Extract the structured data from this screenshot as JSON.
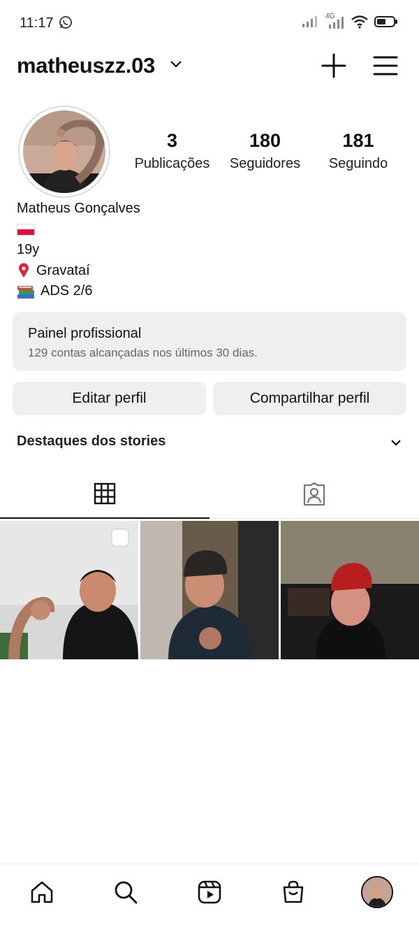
{
  "status_bar": {
    "time": "11:17",
    "network": "4G"
  },
  "header": {
    "username": "matheuszz.03"
  },
  "profile": {
    "stats": [
      {
        "value": "3",
        "label": "Publicações"
      },
      {
        "value": "180",
        "label": "Seguidores"
      },
      {
        "value": "181",
        "label": "Seguindo"
      }
    ],
    "name": "Matheus Gonçalves",
    "bio": {
      "age": "19y",
      "location": "Gravataí",
      "course": "ADS 2/6"
    }
  },
  "pro_panel": {
    "title": "Painel profissional",
    "subtitle": "129 contas alcançadas nos últimos 30 dias."
  },
  "buttons": {
    "edit": "Editar perfil",
    "share": "Compartilhar perfil"
  },
  "highlights": {
    "title": "Destaques dos stories"
  },
  "colors": {
    "panel_bg": "#efefef",
    "text": "#111111",
    "secondary": "#666666"
  }
}
